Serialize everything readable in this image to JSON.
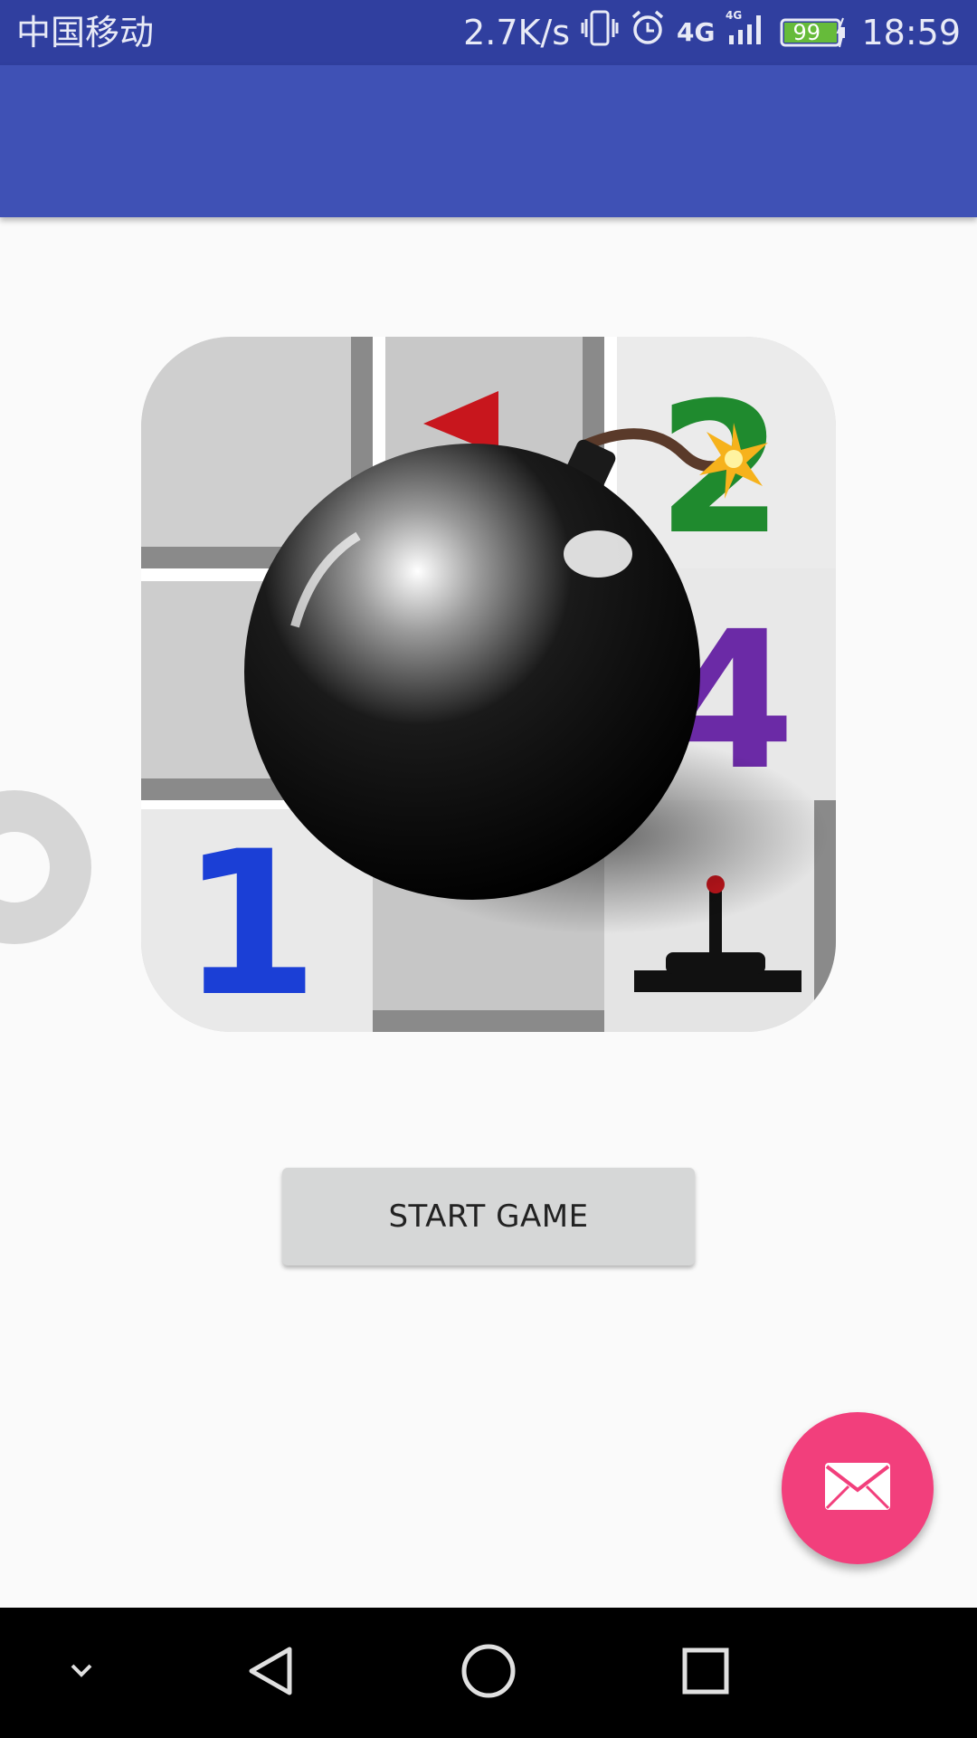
{
  "status_bar": {
    "carrier": "中国移动",
    "speed": "2.7K/s",
    "network_label": "4G",
    "battery": "99",
    "time": "18:59"
  },
  "main": {
    "start_button_label": "START GAME",
    "image_numbers": {
      "one": "1",
      "two": "2",
      "four": "4"
    }
  },
  "colors": {
    "app_bar": "#3f51b5",
    "status_bar": "#303f9f",
    "fab": "#f23f7c",
    "background": "#fafafa"
  },
  "icons": {
    "fab": "mail-icon",
    "nav_hide": "chevron-down-icon",
    "nav_back": "back-triangle-icon",
    "nav_home": "home-circle-icon",
    "nav_recents": "recents-square-icon"
  }
}
